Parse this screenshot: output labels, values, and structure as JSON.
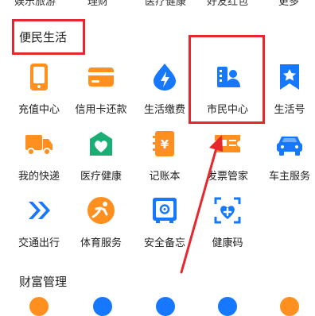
{
  "top_row": [
    "娱乐旅游",
    "理财",
    "医疗健康",
    "好友红包",
    "更多"
  ],
  "section1": {
    "title": "便民生活",
    "items": [
      {
        "label": "充值中心",
        "icon": "phone-icon"
      },
      {
        "label": "信用卡还款",
        "icon": "credit-card-icon"
      },
      {
        "label": "生活缴费",
        "icon": "utility-bolt-icon"
      },
      {
        "label": "市民中心",
        "icon": "citizen-center-icon"
      },
      {
        "label": "生活号",
        "icon": "bookmark-star-icon"
      },
      {
        "label": "我的快递",
        "icon": "delivery-truck-icon"
      },
      {
        "label": "医疗健康",
        "icon": "medical-heart-icon"
      },
      {
        "label": "记账本",
        "icon": "ledger-yen-icon"
      },
      {
        "label": "发票管家",
        "icon": "invoice-ticket-icon"
      },
      {
        "label": "车主服务",
        "icon": "car-icon"
      },
      {
        "label": "交通出行",
        "icon": "transit-arrows-icon"
      },
      {
        "label": "体育服务",
        "icon": "sports-icon"
      },
      {
        "label": "安全备忘",
        "icon": "safe-icon"
      },
      {
        "label": "健康码",
        "icon": "health-code-icon"
      }
    ]
  },
  "section2": {
    "title": "财富管理"
  },
  "colors": {
    "blue": "#1677ff",
    "orange": "#ff8f1f",
    "green": "#1aad74",
    "annotation_red": "#e8262d"
  }
}
